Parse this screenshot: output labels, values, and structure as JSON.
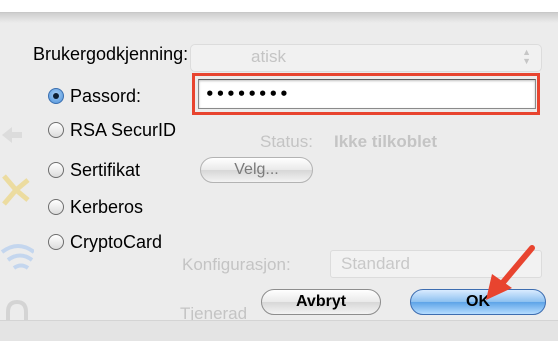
{
  "dialog": {
    "heading": "Brukergodkjenning:",
    "auth_options": [
      {
        "label": "Passord:",
        "selected": true
      },
      {
        "label": "RSA SecurID",
        "selected": false
      },
      {
        "label": "Sertifikat",
        "selected": false
      },
      {
        "label": "Kerberos",
        "selected": false
      },
      {
        "label": "CryptoCard",
        "selected": false
      }
    ],
    "password_value": "••••••••",
    "choose_button": "Velg...",
    "cancel_button": "Avbryt",
    "ok_button": "OK"
  },
  "background": {
    "popup_partial": "atisk",
    "status_label": "Status:",
    "status_value": "Ikke tilkoblet",
    "config_label": "Konfigurasjon:",
    "config_value": "Standard",
    "server_partial": "Tjenerad"
  },
  "colors": {
    "highlight": "#e8442f",
    "ok_button": "#5ea4e8",
    "arrow": "#e8442f"
  }
}
